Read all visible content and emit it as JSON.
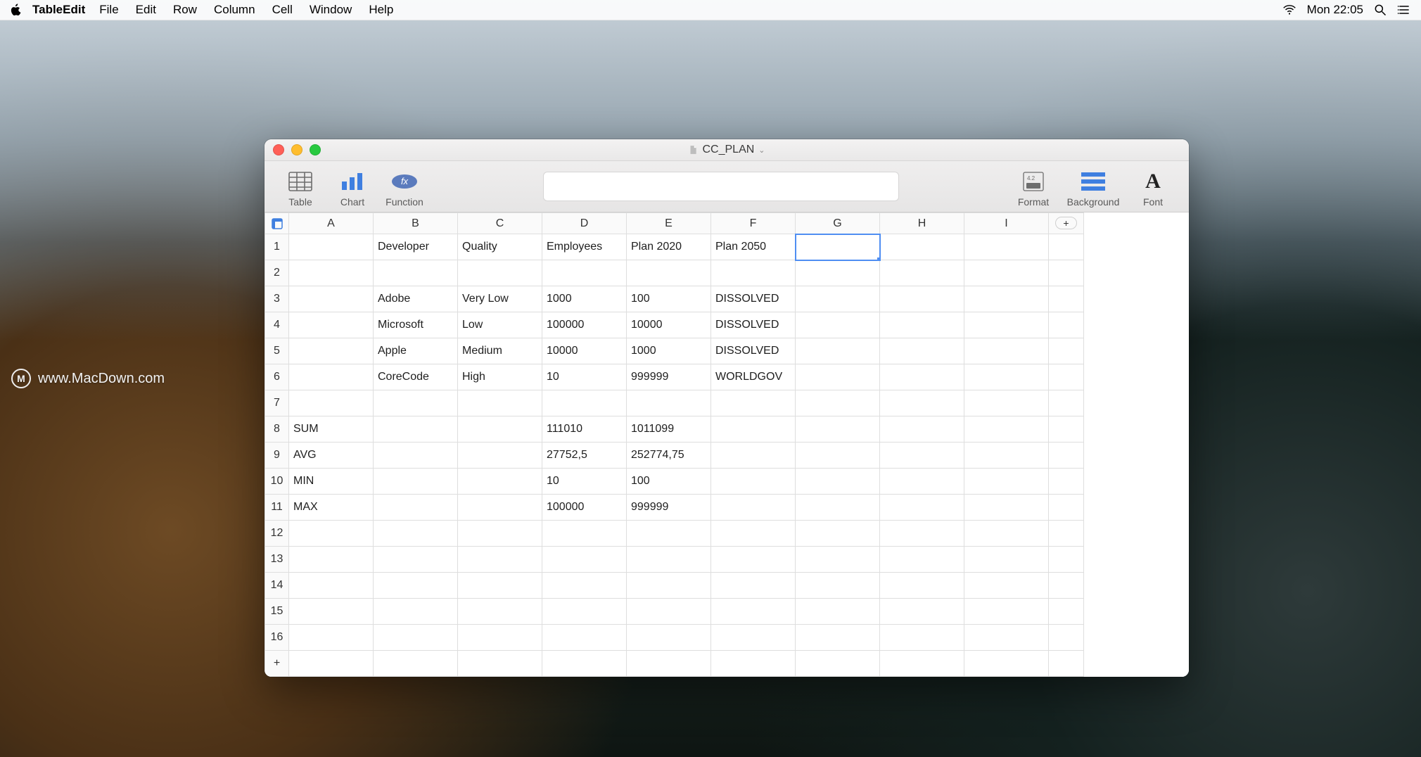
{
  "menubar": {
    "app_name": "TableEdit",
    "items": [
      "File",
      "Edit",
      "Row",
      "Column",
      "Cell",
      "Window",
      "Help"
    ],
    "clock": "Mon 22:05"
  },
  "watermark": "www.MacDown.com",
  "window": {
    "title": "CC_PLAN",
    "toolbar": {
      "left": [
        {
          "name": "table",
          "label": "Table"
        },
        {
          "name": "chart",
          "label": "Chart"
        },
        {
          "name": "function",
          "label": "Function"
        }
      ],
      "right": [
        {
          "name": "format",
          "label": "Format"
        },
        {
          "name": "background",
          "label": "Background"
        },
        {
          "name": "font",
          "label": "Font"
        }
      ],
      "formula_value": ""
    },
    "columns": [
      "A",
      "B",
      "C",
      "D",
      "E",
      "F",
      "G",
      "H",
      "I"
    ],
    "row_numbers": [
      "1",
      "2",
      "3",
      "4",
      "5",
      "6",
      "7",
      "8",
      "9",
      "10",
      "11",
      "12",
      "13",
      "14",
      "15",
      "16"
    ],
    "selected_cell": "G1",
    "add_row_label": "+",
    "add_col_label": "+",
    "cells": {
      "1": {
        "B": "Developer",
        "C": "Quality",
        "D": "Employees",
        "E": "Plan 2020",
        "F": "Plan 2050"
      },
      "3": {
        "B": "Adobe",
        "C": "Very Low",
        "D": "1000",
        "E": "100",
        "F": "DISSOLVED"
      },
      "4": {
        "B": "Microsoft",
        "C": "Low",
        "D": "100000",
        "E": "10000",
        "F": "DISSOLVED"
      },
      "5": {
        "B": "Apple",
        "C": "Medium",
        "D": "10000",
        "E": "1000",
        "F": "DISSOLVED"
      },
      "6": {
        "B": "CoreCode",
        "C": "High",
        "D": "10",
        "E": "999999",
        "F": "WORLDGOV"
      },
      "8": {
        "A": "SUM",
        "D": "111010",
        "E": "1011099"
      },
      "9": {
        "A": "AVG",
        "D": "27752,5",
        "E": "252774,75"
      },
      "10": {
        "A": "MIN",
        "D": "10",
        "E": "100"
      },
      "11": {
        "A": "MAX",
        "D": "100000",
        "E": "999999"
      }
    }
  },
  "chart_data": {
    "type": "table",
    "title": "CC_PLAN",
    "columns": [
      "Developer",
      "Quality",
      "Employees",
      "Plan 2020",
      "Plan 2050"
    ],
    "rows": [
      [
        "Adobe",
        "Very Low",
        1000,
        100,
        "DISSOLVED"
      ],
      [
        "Microsoft",
        "Low",
        100000,
        10000,
        "DISSOLVED"
      ],
      [
        "Apple",
        "Medium",
        10000,
        1000,
        "DISSOLVED"
      ],
      [
        "CoreCode",
        "High",
        10,
        999999,
        "WORLDGOV"
      ]
    ],
    "aggregates": {
      "SUM": {
        "Employees": 111010,
        "Plan 2020": 1011099
      },
      "AVG": {
        "Employees": 27752.5,
        "Plan 2020": 252774.75
      },
      "MIN": {
        "Employees": 10,
        "Plan 2020": 100
      },
      "MAX": {
        "Employees": 100000,
        "Plan 2020": 999999
      }
    }
  }
}
